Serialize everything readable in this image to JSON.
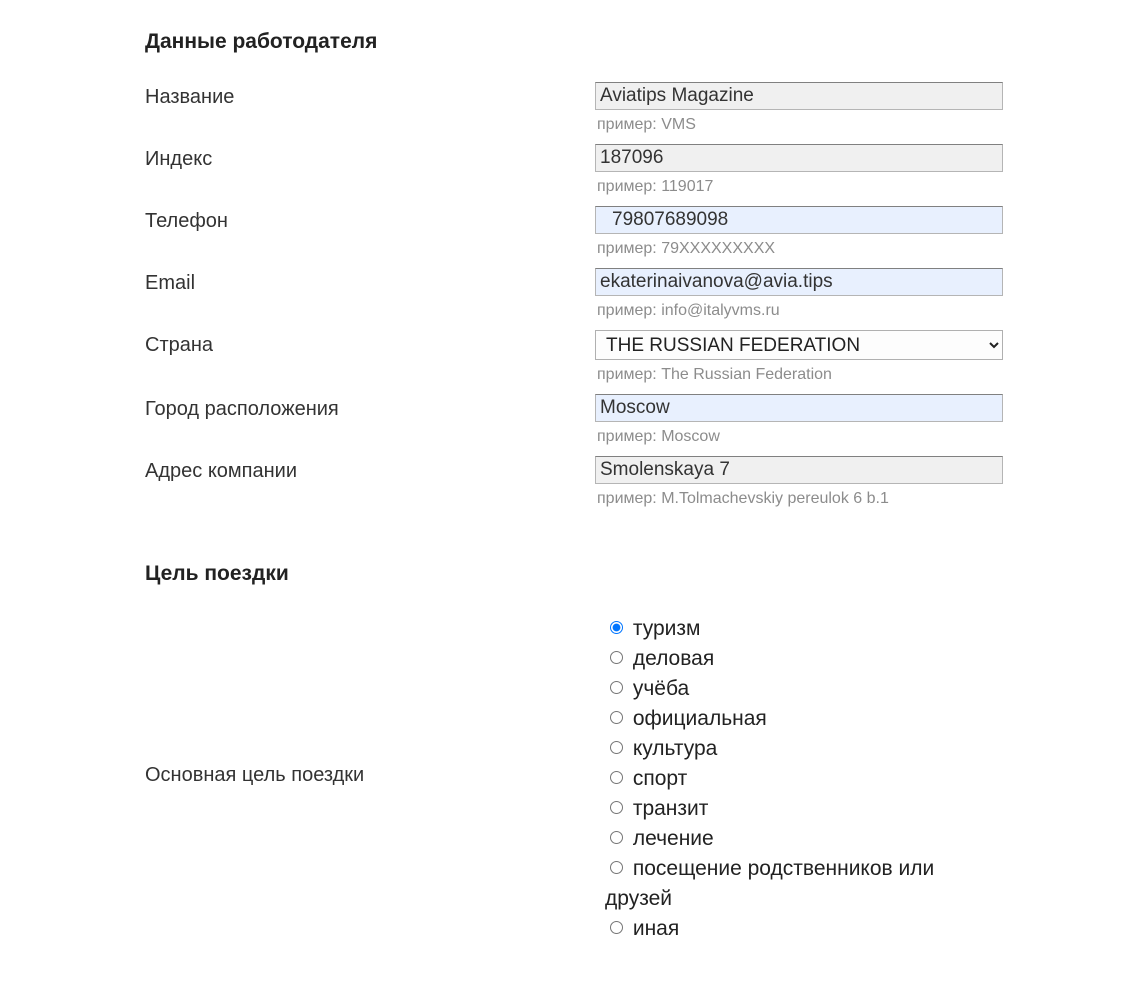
{
  "employer": {
    "title": "Данные работодателя",
    "fields": {
      "name": {
        "label": "Название",
        "value": "Aviatips Magazine",
        "hint": "пример: VMS"
      },
      "index": {
        "label": "Индекс",
        "value": "187096",
        "hint": "пример: 119017"
      },
      "phone": {
        "label": "Телефон",
        "value": "79807689098",
        "hint": "пример: 79XXXXXXXXX"
      },
      "email": {
        "label": "Email",
        "value": "ekaterinaivanova@avia.tips",
        "hint": "пример: info@italyvms.ru"
      },
      "country": {
        "label": "Страна",
        "value": "THE RUSSIAN FEDERATION",
        "hint": "пример: The Russian Federation"
      },
      "city": {
        "label": "Город расположения",
        "value": "Moscow",
        "hint": "пример: Moscow"
      },
      "address": {
        "label": "Адрес компании",
        "value": "Smolenskaya 7",
        "hint": "пример: M.Tolmachevskiy pereulok 6 b.1"
      }
    }
  },
  "trip": {
    "title": "Цель поездки",
    "purpose_label": "Основная цель поездки",
    "options": [
      "туризм",
      "деловая",
      "учёба",
      "официальная",
      "культура",
      "спорт",
      "транзит",
      "лечение",
      "посещение родственников или друзей",
      "иная"
    ],
    "selected": "туризм"
  }
}
